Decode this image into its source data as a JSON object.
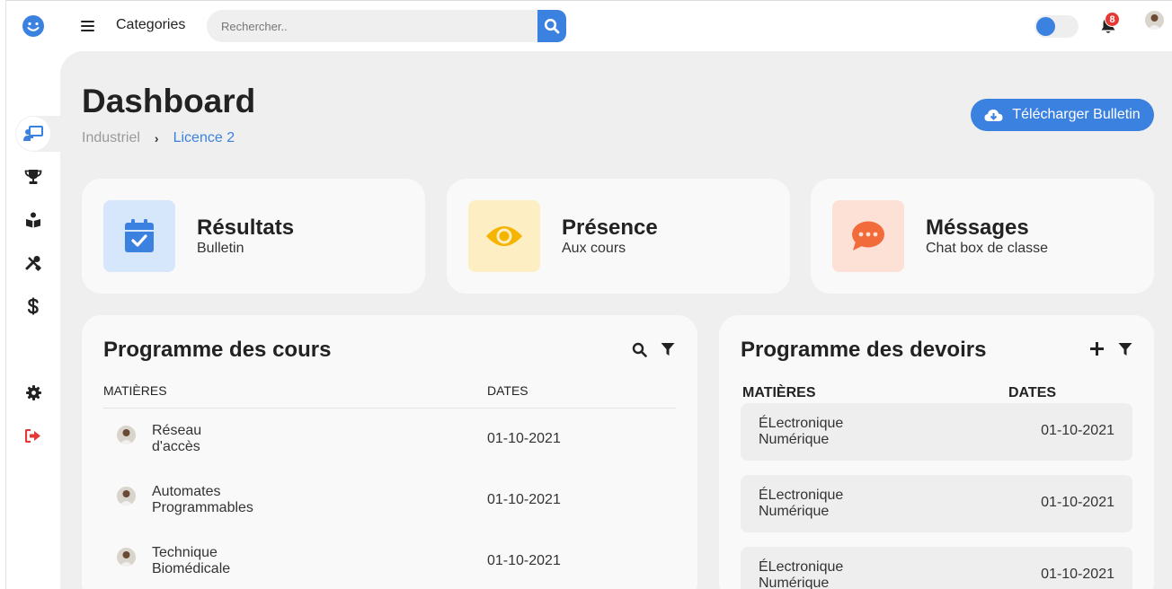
{
  "topbar": {
    "menu_label": "Categories",
    "search_placeholder": "Rechercher..",
    "notification_count": "8",
    "accent_color": "#3b82e0"
  },
  "sidebar": {
    "items": [
      {
        "icon": "presentation-icon",
        "active": true
      },
      {
        "icon": "trophy-icon"
      },
      {
        "icon": "book-reader-icon"
      },
      {
        "icon": "tools-icon"
      },
      {
        "icon": "dollar-icon"
      },
      {
        "icon": "gear-icon"
      },
      {
        "icon": "sign-out-icon"
      }
    ]
  },
  "header": {
    "title": "Dashboard",
    "breadcrumb": [
      "Industriel",
      "Licence 2"
    ],
    "download_label": "Télécharger Bulletin"
  },
  "stats": [
    {
      "title": "Résultats",
      "subtitle": "Bulletin",
      "icon": "calendar-check-icon",
      "bg": "#d6e6fb",
      "color": "#3b82e0"
    },
    {
      "title": "Présence",
      "subtitle": "Aux cours",
      "icon": "eye-icon",
      "bg": "#fdefc3",
      "color": "#f4b400"
    },
    {
      "title": "Méssages",
      "subtitle": "Chat box de classe",
      "icon": "chat-icon",
      "bg": "#fde0d6",
      "color": "#f26b3a"
    }
  ],
  "courses": {
    "title": "Programme des cours",
    "headers": [
      "MATIÈRES",
      "DATES"
    ],
    "rows": [
      {
        "subject_1": "Réseau",
        "subject_2": "d'accès",
        "date": "01-10-2021"
      },
      {
        "subject_1": "Automates",
        "subject_2": "Programmables",
        "date": "01-10-2021"
      },
      {
        "subject_1": "Technique",
        "subject_2": "Biomédicale",
        "date": "01-10-2021"
      }
    ]
  },
  "homework": {
    "title": "Programme des devoirs",
    "headers": [
      "MATIÈRES",
      "DATES"
    ],
    "rows": [
      {
        "subject_1": "ÉLectronique",
        "subject_2": "Numérique",
        "date": "01-10-2021"
      },
      {
        "subject_1": "ÉLectronique",
        "subject_2": "Numérique",
        "date": "01-10-2021"
      },
      {
        "subject_1": "ÉLectronique",
        "subject_2": "Numérique",
        "date": "01-10-2021"
      }
    ]
  }
}
